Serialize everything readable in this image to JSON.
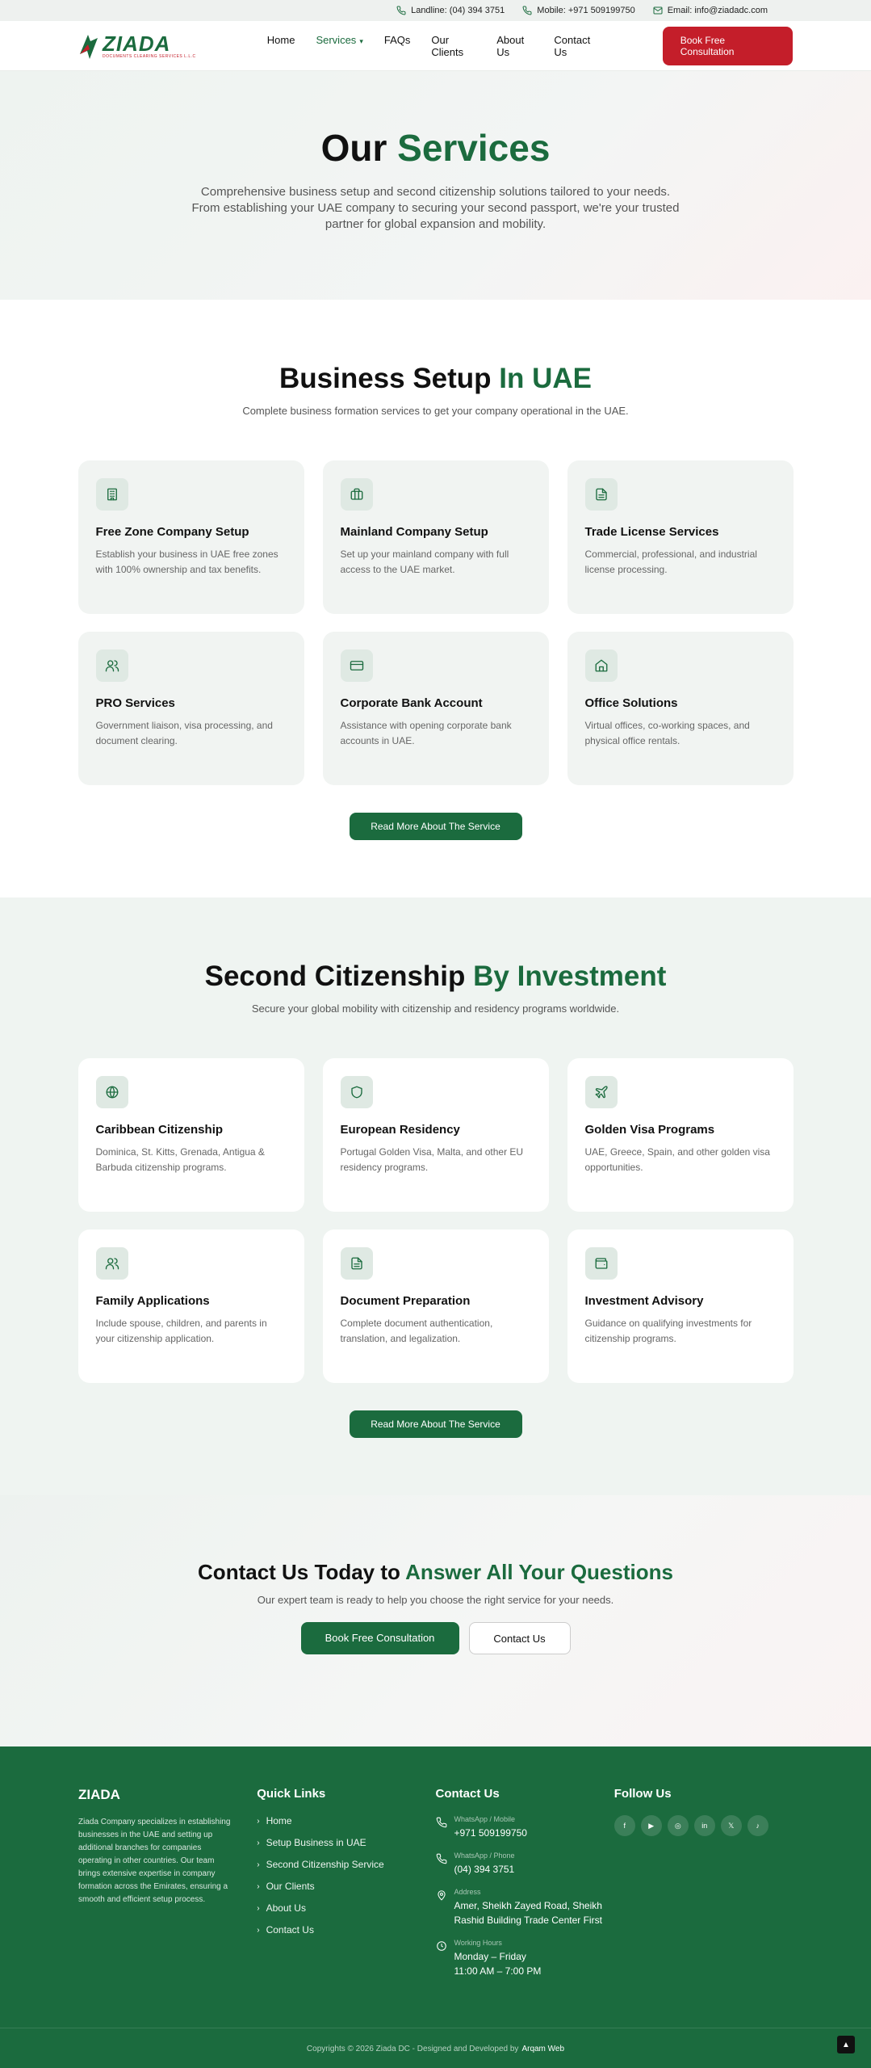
{
  "topbar": {
    "landline": "Landline: (04) 394 3751",
    "mobile": "Mobile: +971 509199750",
    "email": "Email: info@ziadadc.com"
  },
  "nav": {
    "logo_text": "ZIADA",
    "logo_sub": "DOCUMENTS CLEARING SERVICES L.L.C",
    "items": [
      "Home",
      "Services",
      "FAQs",
      "Our Clients",
      "About Us",
      "Contact Us"
    ],
    "active": "Services",
    "cta": "Book Free Consultation"
  },
  "hero": {
    "title_a": "Our",
    "title_b": "Services",
    "text": "Comprehensive business setup and second citizenship solutions tailored to your needs. From establishing your UAE company to securing your second passport, we're your trusted partner for global expansion and mobility."
  },
  "business": {
    "title_a": "Business Setup",
    "title_b": "In UAE",
    "subtitle": "Complete business formation services to get your company operational in the UAE.",
    "cards": [
      {
        "icon": "building-icon",
        "title": "Free Zone Company Setup",
        "text": "Establish your business in UAE free zones with 100% ownership and tax benefits."
      },
      {
        "icon": "briefcase-icon",
        "title": "Mainland Company Setup",
        "text": "Set up your mainland company with full access to the UAE market."
      },
      {
        "icon": "document-icon",
        "title": "Trade License Services",
        "text": "Commercial, professional, and industrial license processing."
      },
      {
        "icon": "users-icon",
        "title": "PRO Services",
        "text": "Government liaison, visa processing, and document clearing."
      },
      {
        "icon": "credit-card-icon",
        "title": "Corporate Bank Account",
        "text": "Assistance with opening corporate bank accounts in UAE."
      },
      {
        "icon": "home-icon",
        "title": "Office Solutions",
        "text": "Virtual offices, co-working spaces, and physical office rentals."
      }
    ],
    "button": "Read More About The Service"
  },
  "citizenship": {
    "title_a": "Second Citizenship",
    "title_b": "By Investment",
    "subtitle": "Secure your global mobility with citizenship and residency programs worldwide.",
    "cards": [
      {
        "icon": "globe-icon",
        "title": "Caribbean Citizenship",
        "text": "Dominica, St. Kitts, Grenada, Antigua & Barbuda citizenship programs."
      },
      {
        "icon": "shield-icon",
        "title": "European Residency",
        "text": "Portugal Golden Visa, Malta, and other EU residency programs."
      },
      {
        "icon": "plane-icon",
        "title": "Golden Visa Programs",
        "text": "UAE, Greece, Spain, and other golden visa opportunities."
      },
      {
        "icon": "users-icon",
        "title": "Family Applications",
        "text": "Include spouse, children, and parents in your citizenship application."
      },
      {
        "icon": "document-icon",
        "title": "Document Preparation",
        "text": "Complete document authentication, translation, and legalization."
      },
      {
        "icon": "wallet-icon",
        "title": "Investment Advisory",
        "text": "Guidance on qualifying investments for citizenship programs."
      }
    ],
    "button": "Read More About The Service"
  },
  "cta": {
    "title_a": "Contact Us Today to",
    "title_b": "Answer All Your Questions",
    "text": "Our expert team is ready to help you choose the right service for your needs.",
    "primary": "Book Free Consultation",
    "secondary": "Contact Us"
  },
  "footer": {
    "brand": "ZIADA",
    "description": "Ziada Company specializes in establishing businesses in the UAE and setting up additional branches for companies operating in other countries. Our team brings extensive expertise in company formation across the Emirates, ensuring a smooth and efficient setup process.",
    "quick_links_title": "Quick Links",
    "quick_links": [
      "Home",
      "Setup Business in UAE",
      "Second Citizenship Service",
      "Our Clients",
      "About Us",
      "Contact Us"
    ],
    "contact_title": "Contact Us",
    "contacts": [
      {
        "icon": "phone-icon",
        "label": "WhatsApp / Mobile",
        "value": "+971 509199750"
      },
      {
        "icon": "phone-icon",
        "label": "WhatsApp / Phone",
        "value": "(04) 394 3751"
      },
      {
        "icon": "map-pin-icon",
        "label": "Address",
        "value": "Amer, Sheikh Zayed Road, Sheikh Rashid Building Trade Center First"
      },
      {
        "icon": "clock-icon",
        "label": "Working Hours",
        "value": "Monday – Friday",
        "value2": "11:00 AM – 7:00 PM"
      }
    ],
    "follow_title": "Follow Us",
    "social": [
      "facebook-icon",
      "youtube-icon",
      "instagram-icon",
      "linkedin-icon",
      "twitter-icon",
      "tiktok-icon"
    ],
    "copyright": "Copyrights © 2026 Ziada DC - Designed and Developed by",
    "developer": "Arqam Web"
  },
  "colors": {
    "brand_green": "#1b6b3e",
    "brand_red": "#c41e2a"
  }
}
